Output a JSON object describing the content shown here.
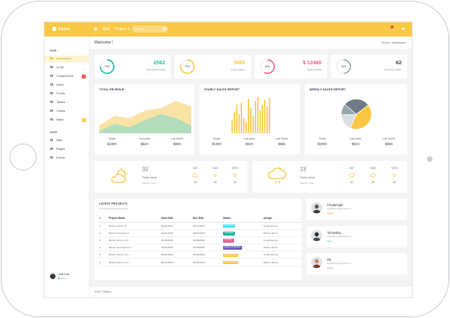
{
  "app": {
    "brand": "Xenon",
    "nav_email": "Mail",
    "nav_project": "Project ▾"
  },
  "search": {
    "placeholder": "Search..."
  },
  "sidebar": {
    "sections": [
      "MAIN",
      "MORE"
    ],
    "main_items": [
      {
        "label": "Dashboard",
        "icon": "home-icon"
      },
      {
        "label": "UI Kit",
        "icon": "palette-icon"
      },
      {
        "label": "Components",
        "icon": "layers-icon",
        "badge": "7"
      },
      {
        "label": "Icons",
        "icon": "star-icon"
      },
      {
        "label": "Forms",
        "icon": "edit-icon"
      },
      {
        "label": "Tables",
        "icon": "table-icon"
      },
      {
        "label": "Charts",
        "icon": "chart-icon"
      },
      {
        "label": "Maps",
        "icon": "map-icon",
        "badge": "3"
      }
    ],
    "more_items": [
      {
        "label": "Mail",
        "icon": "mail-icon"
      },
      {
        "label": "Pages",
        "icon": "file-icon"
      },
      {
        "label": "Extras",
        "icon": "puzzle-icon"
      }
    ],
    "user": {
      "name": "John Doe",
      "status": "Online"
    }
  },
  "page": {
    "title": "Welcome !",
    "breadcrumb": "Xenon  /  Dashboard"
  },
  "stats": [
    {
      "value": "2562",
      "label": "Total Sales today",
      "pct": "75%",
      "ring_fraction": 0.75,
      "color": "#1bb99a"
    },
    {
      "value": "5685",
      "label": "Daily visitors",
      "pct": "79%",
      "ring_fraction": 0.79,
      "color": "#fbc843"
    },
    {
      "value": "$ 12480",
      "label": "Total Earning",
      "pct": "58%",
      "ring_fraction": 0.58,
      "color": "#f05b8a"
    },
    {
      "value": "62",
      "label": "Pending Orders",
      "pct": "49%",
      "ring_fraction": 0.49,
      "color": "#98a6ad"
    }
  ],
  "revenue": {
    "title": "TOTAL REVENUE",
    "footer": [
      {
        "label": "Target",
        "value": "$1000"
      },
      {
        "label": "Last week",
        "value": "$523"
      },
      {
        "label": "Last Month",
        "value": "$965"
      }
    ]
  },
  "yearly": {
    "title": "YEARLY SALES REPORT",
    "footer": [
      {
        "label": "Target",
        "value": "$1000"
      },
      {
        "label": "Last week",
        "value": "$523"
      },
      {
        "label": "Last Month",
        "value": "$965"
      }
    ]
  },
  "weekly": {
    "title": "WEEKLY SALES REPORT",
    "footer": [
      {
        "label": "Target",
        "value": "$1000"
      },
      {
        "label": "Last week",
        "value": "$523"
      },
      {
        "label": "Last Month",
        "value": "$965"
      }
    ]
  },
  "weather": [
    {
      "temp": "32",
      "desc": "Partly cloudy",
      "sub": "15km/h - 37%",
      "icon": "sun-cloud-icon",
      "days": [
        {
          "day": "SAT",
          "num": "30",
          "icon": "cloud-icon"
        },
        {
          "day": "SUN",
          "num": "28",
          "icon": "sun-icon"
        },
        {
          "day": "MON",
          "num": "28",
          "icon": "sun-icon"
        }
      ]
    },
    {
      "temp": "23",
      "desc": "Partly cloudy",
      "sub": "15km/h - 37%",
      "icon": "cloud-rain-icon",
      "days": [
        {
          "day": "SAT",
          "num": "30",
          "icon": "cloud-icon"
        },
        {
          "day": "SUN",
          "num": "28",
          "icon": "cloud-icon"
        },
        {
          "day": "MON",
          "num": "28",
          "icon": "sun-icon"
        }
      ]
    }
  ],
  "projects": {
    "title": "LATEST PROJECTS",
    "subtitle": "Your awesome text goes here.",
    "columns": [
      "#",
      "Project Name",
      "Start Date",
      "Due Date",
      "Status",
      "Assign"
    ],
    "rows": [
      {
        "n": "1",
        "name": "Minton Admin v1",
        "start": "01/01/2016",
        "due": "26/04/2016",
        "status": "Released",
        "status_color": "#3ddcf7",
        "assign": "Coderthemes"
      },
      {
        "n": "2",
        "name": "Minton Frontend v1",
        "start": "01/01/2016",
        "due": "26/04/2016",
        "status": "Released",
        "status_color": "#1bb99a",
        "assign": "Minton admin"
      },
      {
        "n": "3",
        "name": "Minton Admin v1.1",
        "start": "01/05/2016",
        "due": "10/05/2016",
        "status": "Pending",
        "status_color": "#f05b8a",
        "assign": "Coderthemes"
      },
      {
        "n": "4",
        "name": "Minton Frontend v1.1",
        "start": "01/01/2016",
        "due": "31/05/2016",
        "status": "Work in Progress",
        "status_color": "#7266ba",
        "assign": "Minton admin"
      },
      {
        "n": "5",
        "name": "Minton Admin v1.3",
        "start": "01/01/2016",
        "due": "31/05/2016",
        "status": "Coming soon",
        "status_color": "#fbc843",
        "assign": "Coderthemes"
      },
      {
        "n": "6",
        "name": "Minton Admin v1.3",
        "start": "01/01/2016",
        "due": "31/05/2016",
        "status": "Coming soon",
        "status_color": "#fbc843",
        "assign": "Minton admin"
      }
    ]
  },
  "contacts": [
    {
      "name": "Chadengle",
      "email": "coderthemes@gmail.com",
      "role": "Admin",
      "role_color": "#f0a030"
    },
    {
      "name": "Tomaslau",
      "email": "coderthemes@gmail.com",
      "role": "User",
      "role_color": "#1bb99a"
    },
    {
      "name": "Ok",
      "email": "coderthemes@gmail.com",
      "role": "Admin",
      "role_color": "#f05b8a"
    }
  ],
  "footer": {
    "text": "2016 © Minton."
  },
  "chart_data": [
    {
      "type": "area",
      "title": "TOTAL REVENUE",
      "x": [
        0,
        1,
        2,
        3,
        4,
        5,
        6
      ],
      "ylim": [
        0,
        100
      ],
      "series": [
        {
          "values": [
            20,
            45,
            40,
            60,
            65,
            85,
            70
          ],
          "color": "#f9e2a0"
        },
        {
          "values": [
            5,
            25,
            15,
            35,
            50,
            40,
            20
          ],
          "color": "#a8dcc0"
        }
      ]
    },
    {
      "type": "bar",
      "title": "YEARLY SALES REPORT",
      "categories": [
        "1",
        "2",
        "3",
        "4",
        "5",
        "6",
        "7",
        "8",
        "9",
        "10",
        "11",
        "12",
        "13",
        "14",
        "15",
        "16",
        "17"
      ],
      "values": [
        35,
        55,
        75,
        50,
        80,
        40,
        30,
        90,
        65,
        45,
        85,
        95,
        60,
        75,
        88,
        70,
        92
      ],
      "ylim": [
        0,
        100
      ],
      "color": "#fbc843"
    },
    {
      "type": "pie",
      "title": "WEEKLY SALES REPORT",
      "values": [
        42,
        18,
        12,
        28
      ],
      "colors": [
        "#fbc843",
        "#dcdfe3",
        "#98a6ad",
        "#6e7b87"
      ]
    }
  ]
}
